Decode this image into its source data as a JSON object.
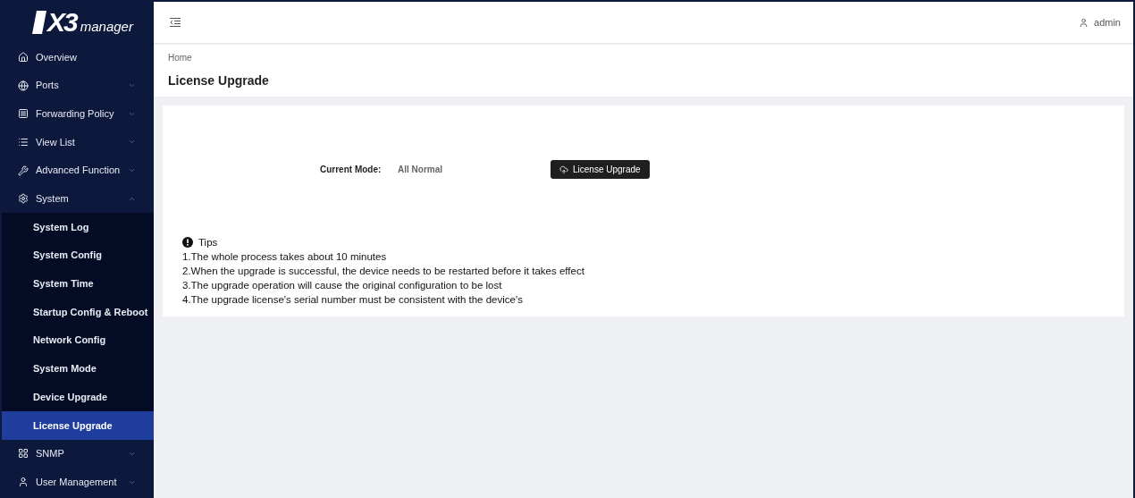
{
  "logo": {
    "mark": "X3",
    "word": "manager"
  },
  "sidebar": {
    "items": [
      {
        "label": "Overview",
        "kind": "link",
        "selected": false
      },
      {
        "label": "Ports",
        "kind": "group",
        "expanded": false
      },
      {
        "label": "Forwarding Policy",
        "kind": "group",
        "expanded": false
      },
      {
        "label": "View List",
        "kind": "group",
        "expanded": false
      },
      {
        "label": "Advanced Function",
        "kind": "group",
        "expanded": false
      },
      {
        "label": "System",
        "kind": "group",
        "expanded": true,
        "children": [
          {
            "label": "System Log",
            "selected": false
          },
          {
            "label": "System Config",
            "selected": false
          },
          {
            "label": "System Time",
            "selected": false
          },
          {
            "label": "Startup Config & Reboot",
            "selected": false
          },
          {
            "label": "Network Config",
            "selected": false
          },
          {
            "label": "System Mode",
            "selected": false
          },
          {
            "label": "Device Upgrade",
            "selected": false
          },
          {
            "label": "License Upgrade",
            "selected": true
          }
        ]
      },
      {
        "label": "SNMP",
        "kind": "group",
        "expanded": false
      },
      {
        "label": "User Management",
        "kind": "group",
        "expanded": false
      }
    ]
  },
  "header": {
    "user": "admin"
  },
  "breadcrumb": "Home",
  "page_title": "License Upgrade",
  "mode": {
    "label": "Current Mode:",
    "value": "All Normal",
    "button": "License Upgrade"
  },
  "tips": {
    "title": "Tips",
    "lines": [
      "1.The whole process takes about 10 minutes",
      "2.When the upgrade is successful, the device needs to be restarted before it takes effect",
      "3.The upgrade operation will cause the original configuration to be lost",
      "4.The upgrade license's serial number must be consistent with the device's"
    ]
  }
}
